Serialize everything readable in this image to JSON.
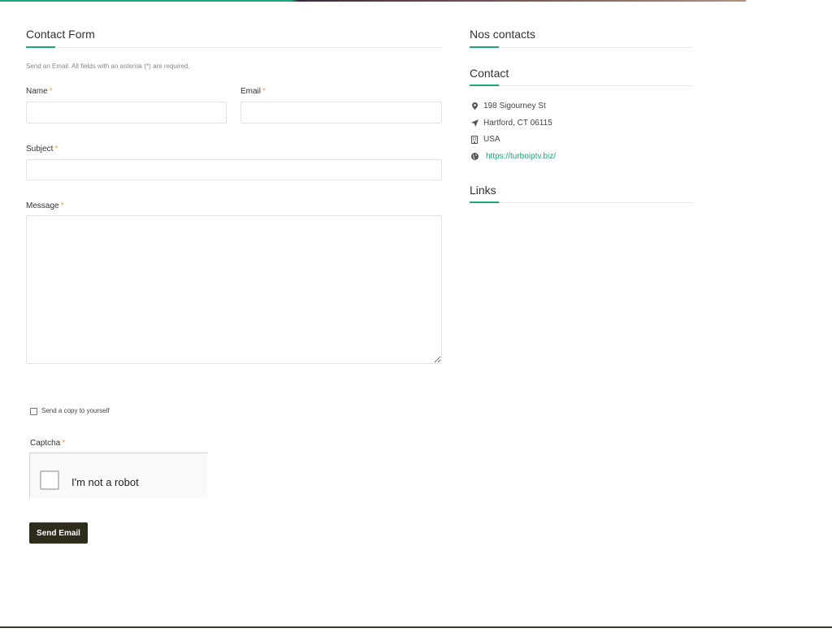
{
  "contact_form": {
    "title": "Contact Form",
    "note": "Send an Email. All fields with an asterisk (*) are required.",
    "required_mark": "*",
    "fields": {
      "name_label": "Name",
      "name_value": "",
      "email_label": "Email",
      "email_value": "",
      "subject_label": "Subject",
      "subject_value": "",
      "message_label": "Message",
      "message_value": ""
    },
    "copy_label": "Send a copy to yourself",
    "captcha_label": "Captcha",
    "captcha_text": "I'm not a robot",
    "send_button": "Send Email"
  },
  "sidebar": {
    "nos_contacts_title": "Nos contacts",
    "contact_title": "Contact",
    "address": "198 Sigourney St",
    "city": "Hartford, CT 06115",
    "country": "USA",
    "website": "https://turboiptv.biz/",
    "links_title": "Links"
  },
  "colors": {
    "accent": "#1aa67c",
    "button": "#2e2d1c",
    "required": "#e8a33a"
  },
  "icons": {
    "address": "map-marker-icon",
    "city": "location-arrow-icon",
    "country": "building-icon",
    "website": "globe-icon"
  }
}
